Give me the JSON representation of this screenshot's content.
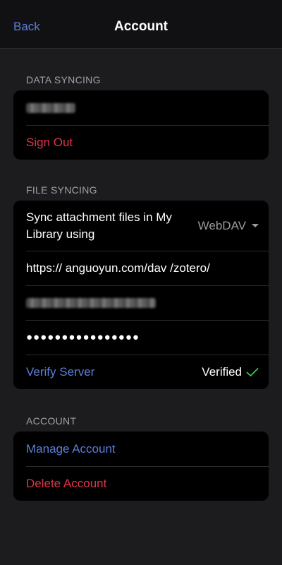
{
  "nav": {
    "back_label": "Back",
    "title": "Account"
  },
  "data_syncing": {
    "header": "DATA SYNCING",
    "username_redacted": "",
    "sign_out_label": "Sign Out"
  },
  "file_syncing": {
    "header": "FILE SYNCING",
    "sync_label": "Sync attachment files in My Library using",
    "sync_method": "WebDAV",
    "url": "https:// anguoyun.com/dav /zotero/",
    "username_redacted": "",
    "password_masked": "●●●●●●●●●●●●●●●●",
    "verify_label": "Verify Server",
    "verified_label": "Verified"
  },
  "account": {
    "header": "ACCOUNT",
    "manage_label": "Manage Account",
    "delete_label": "Delete Account"
  },
  "colors": {
    "accent_blue": "#5b7fd9",
    "destructive_red": "#e0344b",
    "verified_green": "#34c759"
  }
}
